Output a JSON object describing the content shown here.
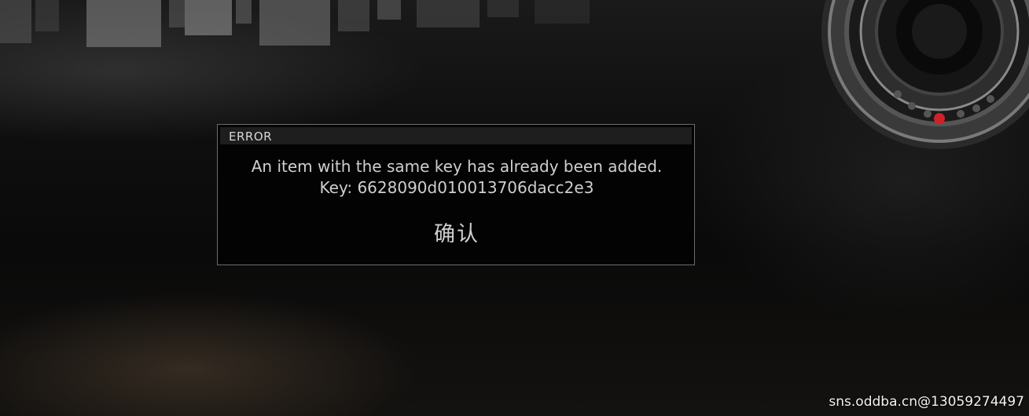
{
  "dialog": {
    "title": "ERROR",
    "message": "An item with the same key has already been added. Key: 6628090d010013706dacc2e3",
    "confirm_label": "确认"
  },
  "watermark": {
    "text": "sns.oddba.cn@13059274497"
  },
  "colors": {
    "dialog_background": "#030303",
    "dialog_border": "#6d6d6d",
    "header_background": "#1e1e1e",
    "text": "#cfcfcf",
    "camera_led": "#d0202a"
  },
  "icons": {
    "camera": "security-camera-lens"
  }
}
